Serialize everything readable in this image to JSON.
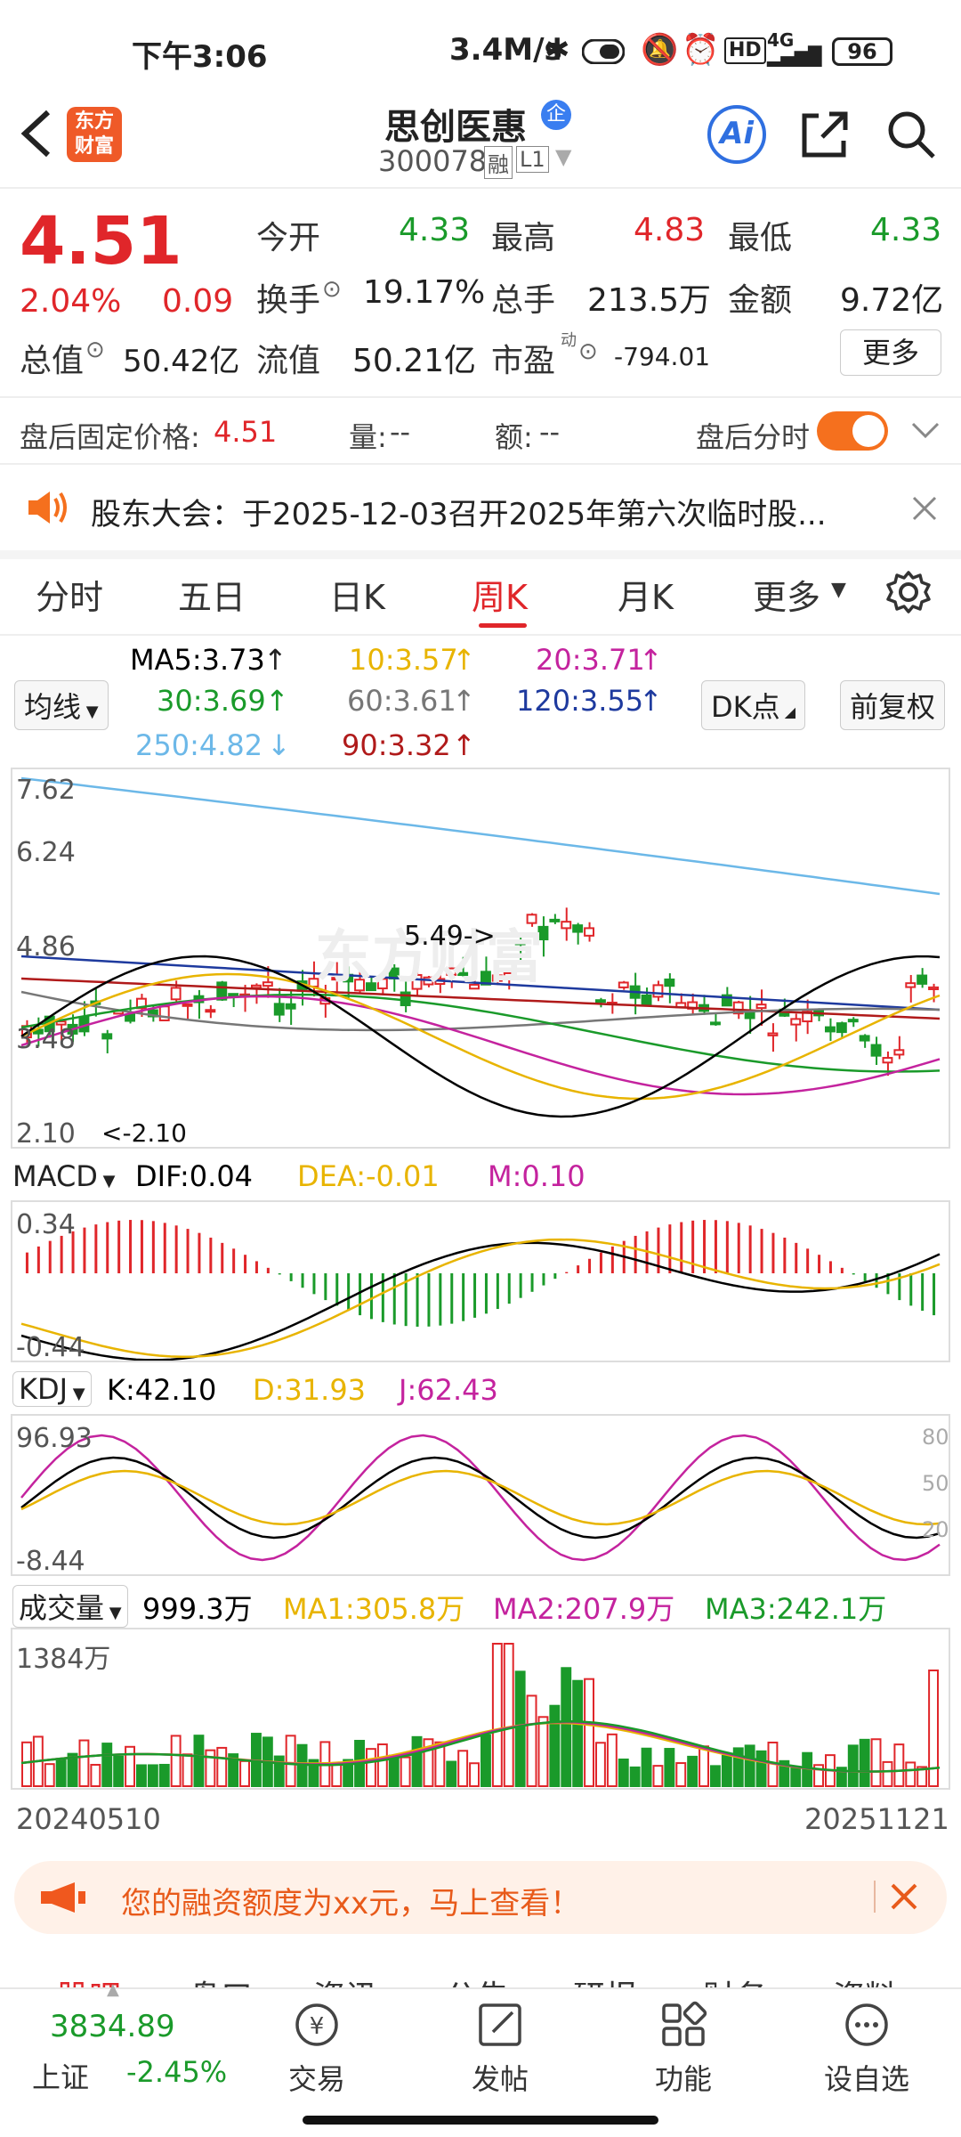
{
  "status": {
    "time": "下午3:06",
    "speed": "3.4M/s",
    "battery": "96"
  },
  "header": {
    "back_icon": "back-arrow-icon",
    "brand_logo": "东方财富",
    "stock_name": "思创医惠",
    "badge": "企",
    "code": "300078",
    "tag_margin": "融",
    "tag_level": "L1",
    "ai_label": "Ai"
  },
  "quote": {
    "price": "4.51",
    "pct": "2.04%",
    "change": "0.09",
    "open_label": "今开",
    "open": "4.33",
    "high_label": "最高",
    "high": "4.83",
    "low_label": "最低",
    "low": "4.33",
    "turnover_label": "换手",
    "turnover": "19.17%",
    "volume_label": "总手",
    "volume": "213.5万",
    "amount_label": "金额",
    "amount": "9.72亿",
    "mcap_label": "总值",
    "mcap": "50.42亿",
    "float_label": "流值",
    "float": "50.21亿",
    "pe_label": "市盈",
    "pe_sup": "动",
    "pe": "-794.01",
    "more_label": "更多"
  },
  "after_hours": {
    "label": "盘后固定价格:",
    "price": "4.51",
    "vol_label": "量:",
    "vol": "--",
    "amt_label": "额:",
    "amt": "--",
    "toggle_label": "盘后分时"
  },
  "notice": {
    "text": "股东大会：于2025-12-03召开2025年第六次临时股..."
  },
  "tabs": [
    "分时",
    "五日",
    "日K",
    "周K",
    "月K",
    "更多"
  ],
  "active_tab": "周K",
  "ma": {
    "selector": "均线",
    "ma5": "MA5:3.73",
    "ma10": "10:3.57",
    "ma20": "20:3.71",
    "ma30": "30:3.69",
    "ma60": "60:3.61",
    "ma120": "120:3.55",
    "ma250": "250:4.82",
    "ma90": "90:3.32",
    "dk_label": "DK点",
    "adjust_label": "前复权"
  },
  "price_axis": [
    "7.62",
    "6.24",
    "4.86",
    "3.48",
    "2.10"
  ],
  "annotations": {
    "high": "5.49->",
    "low": "<-2.10"
  },
  "macd": {
    "selector": "MACD",
    "dif": "DIF:0.04",
    "dea": "DEA:-0.01",
    "m": "M:0.10",
    "axis_top": "0.34",
    "axis_bottom": "-0.44"
  },
  "kdj": {
    "selector": "KDJ",
    "k": "K:42.10",
    "d": "D:31.93",
    "j": "J:62.43",
    "axis_top": "96.93",
    "axis_bottom": "-8.44",
    "levels": [
      "80",
      "50",
      "20"
    ]
  },
  "vol": {
    "selector": "成交量",
    "value": "999.3万",
    "ma1": "MA1:305.8万",
    "ma2": "MA2:207.9万",
    "ma3": "MA3:242.1万",
    "axis_top": "1384万"
  },
  "dates": {
    "start": "20240510",
    "end": "20251121"
  },
  "banner": {
    "text": "您的融资额度为xx元，马上查看！"
  },
  "sub_tabs": [
    "股吧",
    "盘口",
    "资讯",
    "公告",
    "研报",
    "财务",
    "资料"
  ],
  "bottom_bar": {
    "index_value": "3834.89",
    "index_name": "上证",
    "index_pct": "-2.45%",
    "items": [
      "交易",
      "发帖",
      "功能",
      "设自选"
    ]
  },
  "colors": {
    "up": "#e0262a",
    "down": "#1a9a2a",
    "accent": "#f5701e",
    "ma5": "#000000",
    "ma10": "#e8b400",
    "ma20": "#c4239e",
    "ma30": "#1a9a2a",
    "ma60": "#777777",
    "ma120": "#1e3a9e",
    "ma250": "#6cb8e8",
    "ma90": "#b01a1a"
  }
}
